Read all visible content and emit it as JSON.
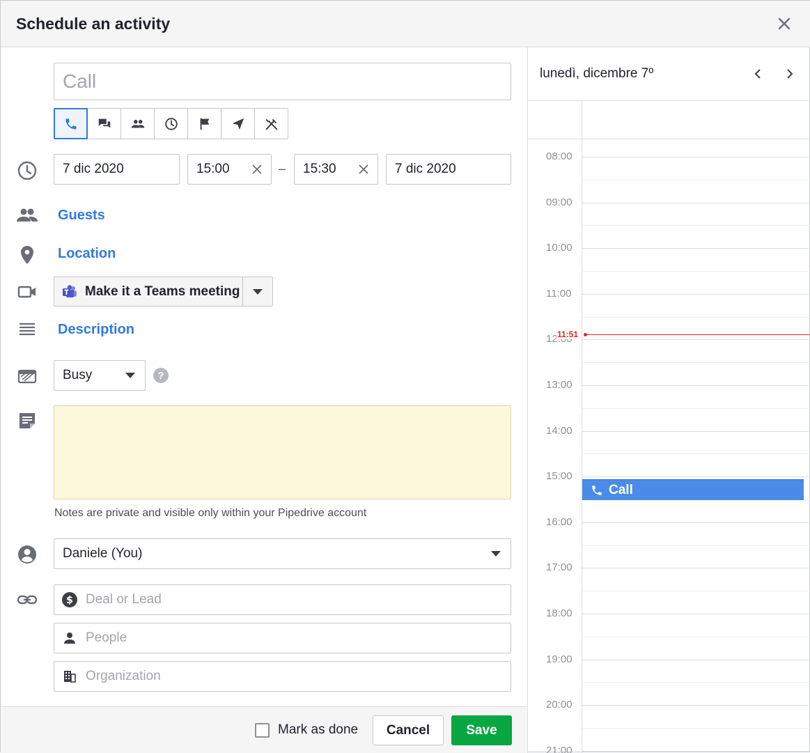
{
  "dialog": {
    "title": "Schedule an activity"
  },
  "subject": {
    "placeholder": "Call"
  },
  "activity_types": [
    "call-icon",
    "meeting-chat-icon",
    "people-icon",
    "clock-icon",
    "flag-icon",
    "send-icon",
    "lunch-icon"
  ],
  "datetime": {
    "start_date": "7 dic 2020",
    "start_time": "15:00",
    "separator": "–",
    "end_time": "15:30",
    "end_date": "7 dic 2020"
  },
  "links": {
    "guests": "Guests",
    "location": "Location",
    "description": "Description"
  },
  "teams": {
    "label": "Make it a Teams meeting"
  },
  "availability": {
    "value": "Busy",
    "help": "?"
  },
  "note": {
    "hint": "Notes are private and visible only within your Pipedrive account"
  },
  "owner": {
    "value": "Daniele (You)"
  },
  "linked": {
    "deal_placeholder": "Deal or Lead",
    "people_placeholder": "People",
    "org_placeholder": "Organization"
  },
  "footer": {
    "mark_done": "Mark as done",
    "cancel": "Cancel",
    "save": "Save"
  },
  "calendar": {
    "date": "lunedì, dicembre 7º",
    "hours": [
      "08:00",
      "09:00",
      "10:00",
      "11:00",
      "12:00",
      "13:00",
      "14:00",
      "15:00",
      "16:00",
      "17:00",
      "18:00",
      "19:00",
      "20:00",
      "21:00"
    ],
    "now": "11:51",
    "event": "Call"
  },
  "colors": {
    "accent": "#317ae2",
    "save": "#08a742",
    "now": "#e0281f",
    "event": "#4a8be8",
    "note": "#fdf8db"
  }
}
